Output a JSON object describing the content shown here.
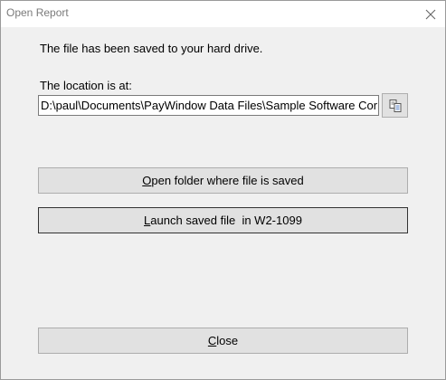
{
  "window": {
    "title": "Open Report"
  },
  "message": "The file has been saved to your hard drive.",
  "location": {
    "label": "The location is at:",
    "path": "D:\\paul\\Documents\\PayWindow Data Files\\Sample Software Cor"
  },
  "buttons": {
    "open_folder": {
      "accel": "O",
      "rest": "pen folder where file is saved"
    },
    "launch_file": {
      "accel": "L",
      "rest": "aunch saved file  in W2-1099"
    },
    "close": {
      "accel": "C",
      "rest": "lose"
    }
  },
  "icons": {
    "close": "close-icon",
    "copy": "copy-icon"
  }
}
